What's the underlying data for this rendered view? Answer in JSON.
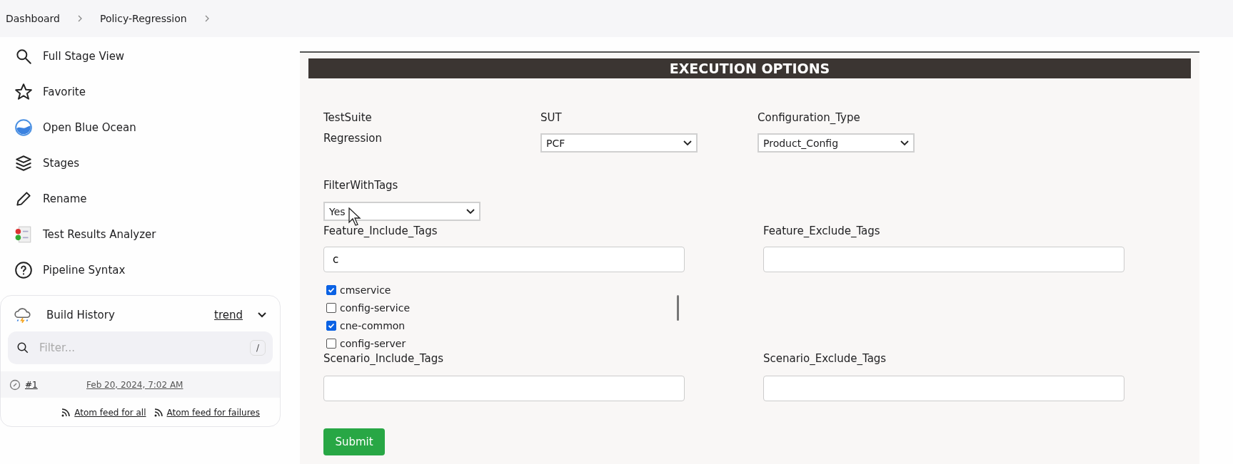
{
  "breadcrumbs": [
    "Dashboard",
    "Policy-Regression"
  ],
  "sidebar": {
    "items": [
      {
        "label": "Full Stage View"
      },
      {
        "label": "Favorite"
      },
      {
        "label": "Open Blue Ocean"
      },
      {
        "label": "Stages"
      },
      {
        "label": "Rename"
      },
      {
        "label": "Test Results Analyzer"
      },
      {
        "label": "Pipeline Syntax"
      }
    ]
  },
  "build_history": {
    "title": "Build History",
    "trend": "trend",
    "filter": {
      "placeholder": "Filter...",
      "shortcut": "/"
    },
    "builds": [
      {
        "number": "#1",
        "date": "Feb 20, 2024, 7:02 AM"
      }
    ],
    "feeds": [
      "Atom feed for all",
      "Atom feed for failures"
    ]
  },
  "form": {
    "title": "EXECUTION OPTIONS",
    "test_suite": {
      "label": "TestSuite",
      "value": "Regression"
    },
    "sut": {
      "label": "SUT",
      "value": "PCF"
    },
    "configuration_type": {
      "label": "Configuration_Type",
      "value": "Product_Config"
    },
    "filter_with_tags": {
      "label": "FilterWithTags",
      "value": "Yes"
    },
    "feature_include_tags": {
      "label": "Feature_Include_Tags",
      "value": "c",
      "options": [
        {
          "label": "cmservice",
          "checked": true
        },
        {
          "label": "config-service",
          "checked": false
        },
        {
          "label": "cne-common",
          "checked": true
        },
        {
          "label": "config-server",
          "checked": false
        }
      ]
    },
    "feature_exclude_tags": {
      "label": "Feature_Exclude_Tags"
    },
    "scenario_include_tags": {
      "label": "Scenario_Include_Tags"
    },
    "scenario_exclude_tags": {
      "label": "Scenario_Exclude_Tags"
    },
    "submit": "Submit"
  }
}
